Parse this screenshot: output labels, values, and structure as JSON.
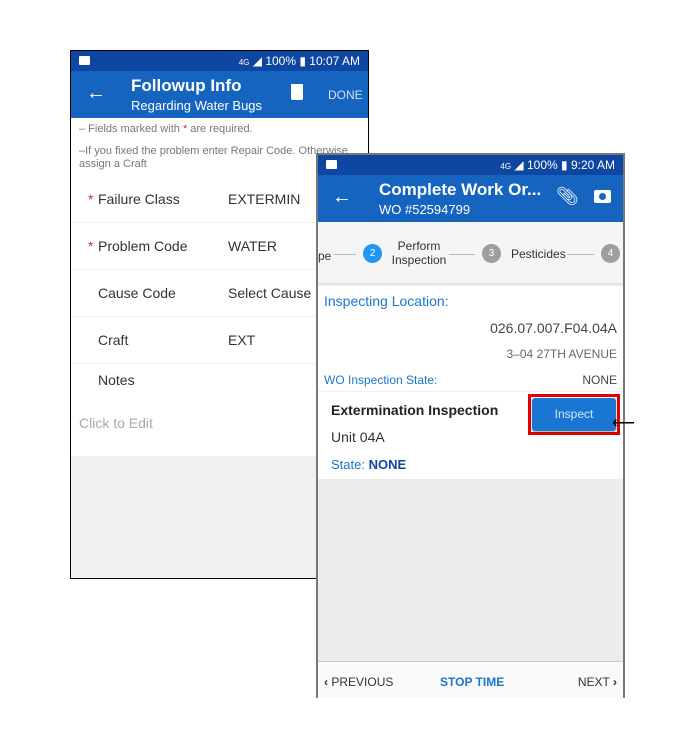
{
  "left_screen": {
    "status_bar": {
      "network": "4G",
      "battery": "100%",
      "time": "10:07 AM"
    },
    "header": {
      "title": "Followup Info",
      "subtitle": "Regarding Water Bugs",
      "done_label": "DONE"
    },
    "notes": {
      "required_prefix": "– Fields marked with ",
      "required_star": "*",
      "required_suffix": " are required.",
      "repair_hint": "–If you fixed the problem enter Repair Code. Otherwise assign a Craft"
    },
    "fields": [
      {
        "label": "Failure Class",
        "required": true,
        "value": "EXTERMIN"
      },
      {
        "label": "Problem Code",
        "required": true,
        "value": "WATER"
      },
      {
        "label": "Cause Code",
        "required": false,
        "value": "Select Cause"
      },
      {
        "label": "Craft",
        "required": false,
        "value": "EXT"
      }
    ],
    "notes_label": "Notes",
    "notes_placeholder": "Click to Edit"
  },
  "right_screen": {
    "status_bar": {
      "network": "4G",
      "battery": "100%",
      "time": "9:20 AM"
    },
    "header": {
      "title": "Complete Work Or...",
      "subtitle": "WO #52594799"
    },
    "stepper": {
      "prev_label": "pe",
      "steps": [
        {
          "number": "2",
          "label": "Perform Inspection",
          "active": true
        },
        {
          "number": "3",
          "label": "Pesticides",
          "active": false
        },
        {
          "number": "4",
          "label": "",
          "active": false
        }
      ]
    },
    "inspecting_location_label": "Inspecting Location:",
    "location_code": "026.07.007.F04.04A",
    "address": "3–04 27TH AVENUE",
    "wo_state_label": "WO Inspection State:",
    "wo_state_value": "NONE",
    "inspection": {
      "title": "Extermination Inspection",
      "unit": "Unit 04A",
      "state_label": "State: ",
      "state_value": "NONE",
      "button": "Inspect"
    },
    "footer": {
      "previous": "PREVIOUS",
      "stop_time": "STOP TIME",
      "next": "NEXT"
    }
  },
  "colors": {
    "primary": "#1565c0",
    "status_bar": "#0d47a1",
    "highlight": "#e00000",
    "required": "#d32f2f"
  }
}
